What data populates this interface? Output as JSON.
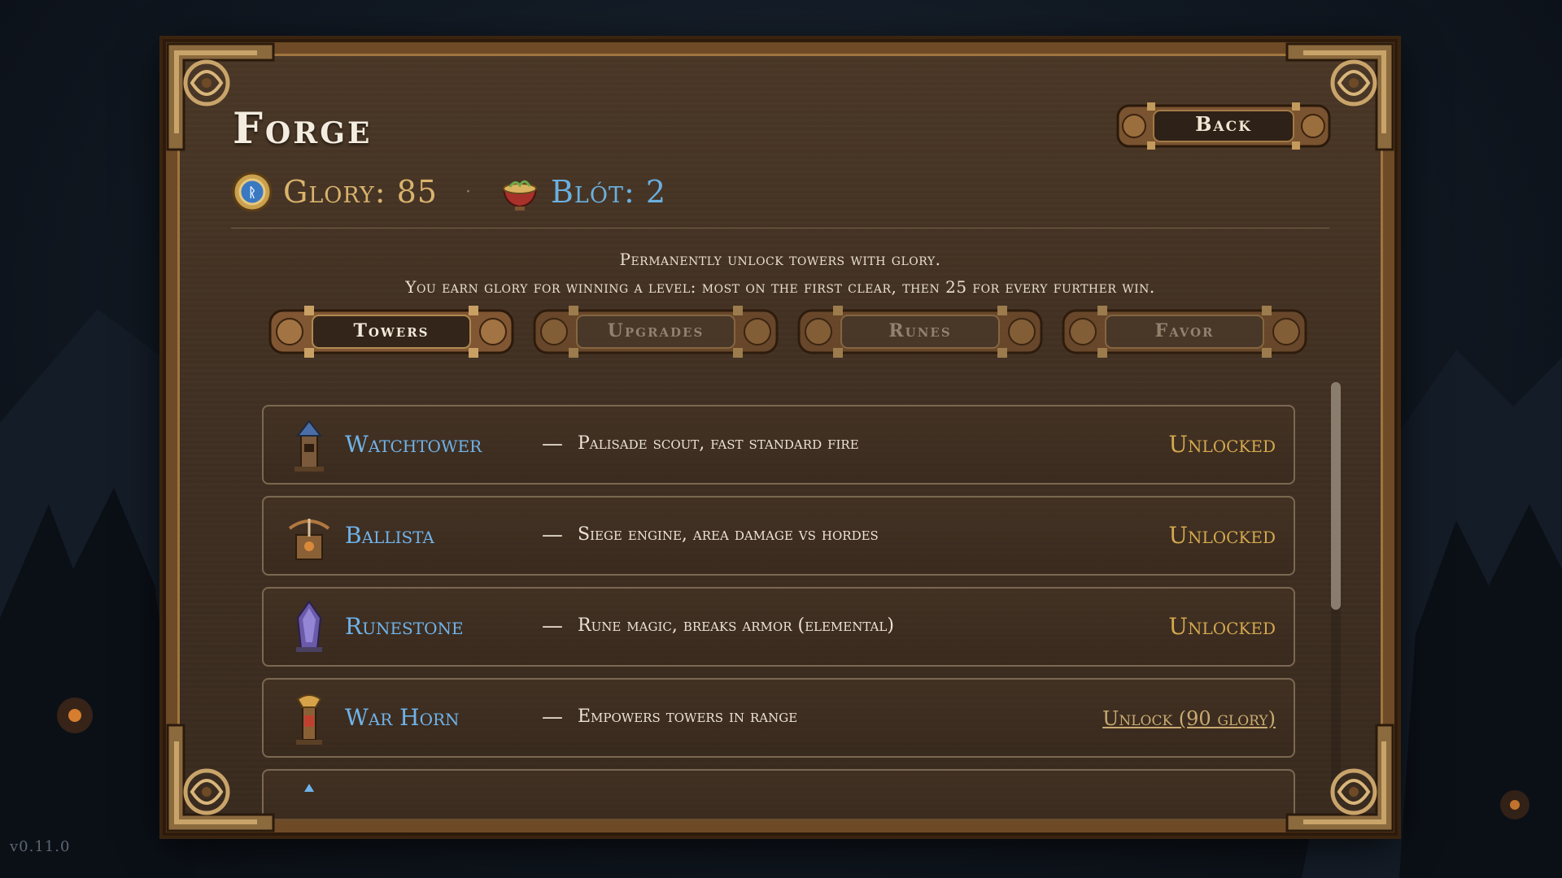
{
  "version": "v0.11.0",
  "header": {
    "title": "Forge",
    "back_label": "Back"
  },
  "currency": {
    "glory_label": "Glory: 85",
    "blot_label": "Blót: 2",
    "separator": "·"
  },
  "description": {
    "line1": "Permanently unlock towers with glory.",
    "line2": "You earn glory for winning a level: most on the first clear, then 25 for every further win."
  },
  "tabs": [
    {
      "label": "Towers",
      "active": true
    },
    {
      "label": "Upgrades",
      "active": false
    },
    {
      "label": "Runes",
      "active": false
    },
    {
      "label": "Favor",
      "active": false
    }
  ],
  "towers": [
    {
      "name": "Watchtower",
      "dash": "—",
      "description": "Palisade scout, fast standard fire",
      "status": "Unlocked",
      "icon": "watchtower-icon"
    },
    {
      "name": "Ballista",
      "dash": "—",
      "description": "Siege engine, area damage vs hordes",
      "status": "Unlocked",
      "icon": "ballista-icon"
    },
    {
      "name": "Runestone",
      "dash": "—",
      "description": "Rune magic, breaks armor (elemental)",
      "status": "Unlocked",
      "icon": "runestone-icon"
    },
    {
      "name": "War Horn",
      "dash": "—",
      "description": "Empowers towers in range",
      "status": "Unlock (90 glory)",
      "icon": "war-horn-icon"
    }
  ],
  "colors": {
    "tower_name": "#6fb3ea",
    "unlocked": "#d4a84f",
    "glory": "#d9b36d",
    "blot": "#6ab0e0"
  }
}
